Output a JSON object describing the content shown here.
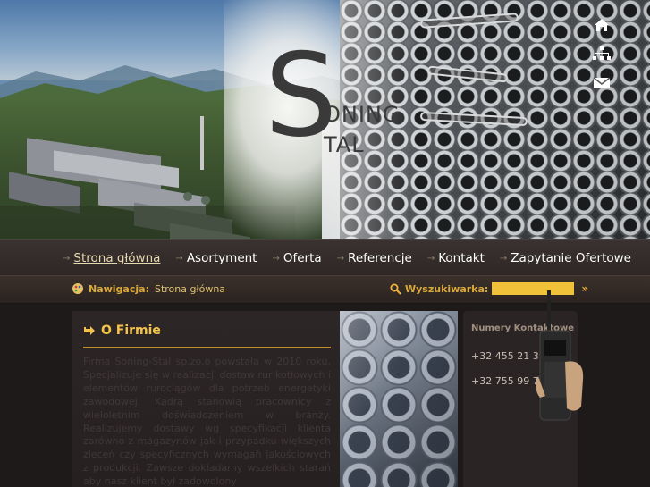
{
  "header": {
    "logo_big_letter": "S",
    "logo_word_1": "ONING",
    "logo_word_2": "TAL",
    "quick_icons": [
      "home-icon",
      "sitemap-icon",
      "email-icon"
    ]
  },
  "nav": {
    "items": [
      {
        "label": "Strona główna",
        "active": true
      },
      {
        "label": "Asortyment",
        "active": false
      },
      {
        "label": "Oferta",
        "active": false
      },
      {
        "label": "Referencje",
        "active": false
      },
      {
        "label": "Kontakt",
        "active": false
      },
      {
        "label": "Zapytanie Ofertowe",
        "active": false
      }
    ]
  },
  "subbar": {
    "nav_label": "Nawigacja:",
    "nav_value": "Strona główna",
    "search_label": "Wyszukiwarka:",
    "search_value": "",
    "go_label": "»"
  },
  "firm": {
    "title": "O Firmie",
    "text": "Firma Soning-Stal sp.zo.o powstała w 2010 roku. Specjalizuje się w realizacji dostaw rur kotłowych i elementów rurociągów dla potrzeb energetyki zawodowej. Kadrą stanowią pracownicy z wieloletnim doświadczeniem w branży. Realizujemy dostawy wg specyfikacji klienta zarówno z magazynów jak i przypadku większych zleceń czy specyficznych wymagań jakościowych z produkcji. Zawsze dokładamy wszelkich starań aby nasz klient był zadowolony"
  },
  "contact": {
    "heading": "Numery Kontaktowe",
    "phone_1": "+32 455 21 30",
    "phone_2": "+32 755 99 70"
  },
  "colors": {
    "accent": "#f3c24a",
    "nav_bg": "#2e2725",
    "content_bg": "#1e1a1a"
  }
}
